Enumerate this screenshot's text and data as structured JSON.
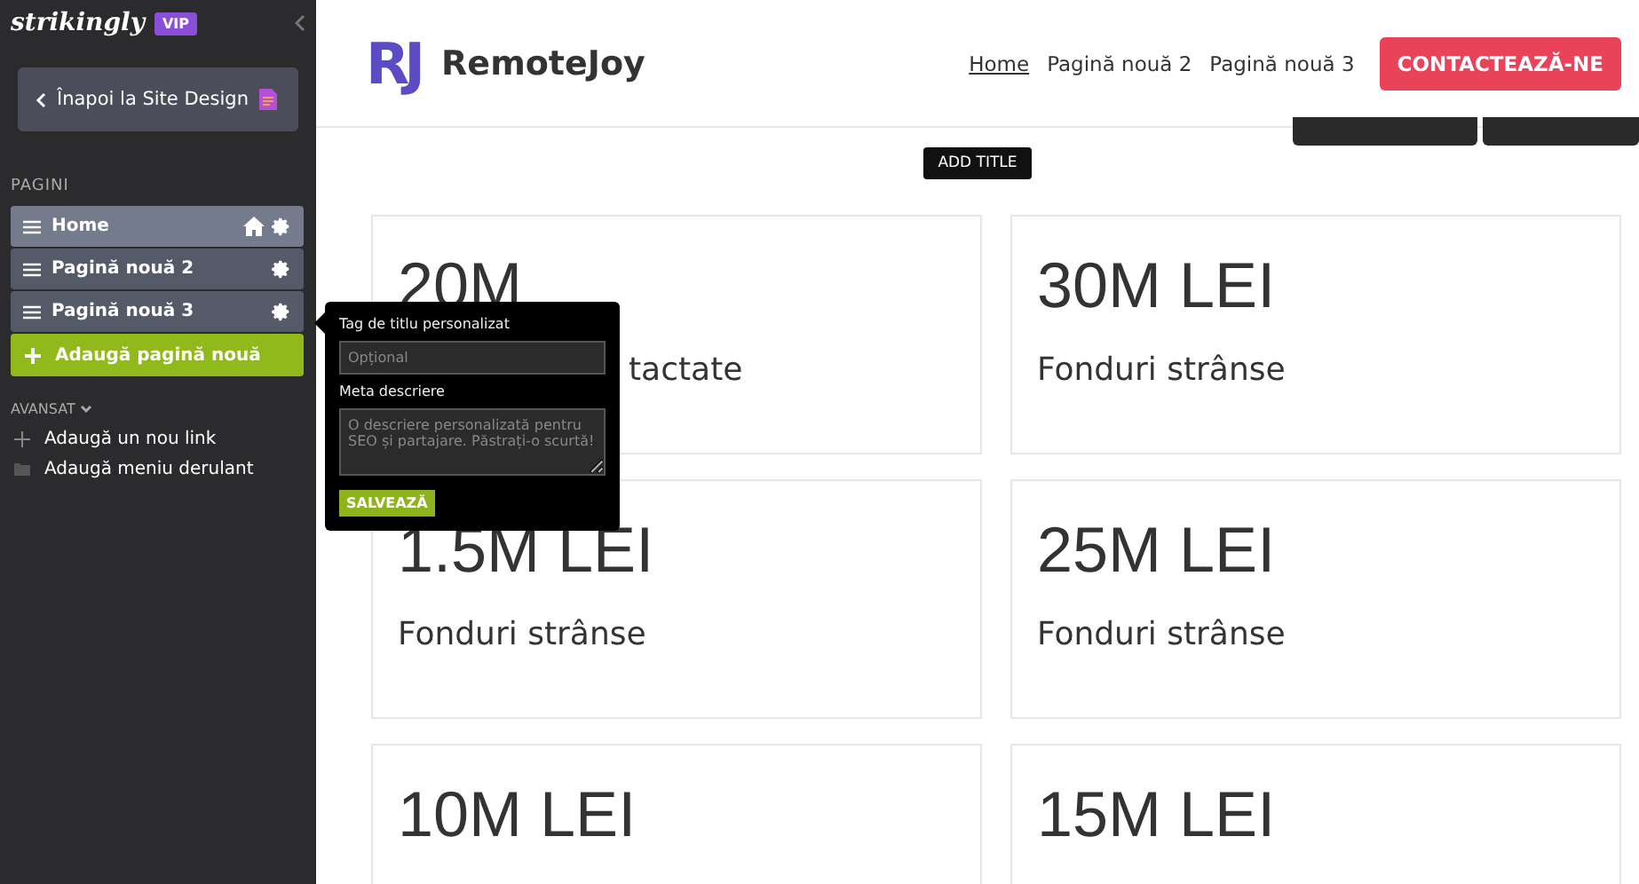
{
  "sidebar": {
    "brand": "strikingly",
    "badge": "VIP",
    "back_button": "Înapoi la Site Design",
    "section_title": "PAGINI",
    "pages": [
      {
        "label": "Home",
        "selected": true,
        "home": true
      },
      {
        "label": "Pagină nouă 2",
        "selected": false,
        "home": false
      },
      {
        "label": "Pagină nouă 3",
        "selected": false,
        "home": false
      }
    ],
    "add_page": "Adaugă pagină nouă",
    "advanced_title": "AVANSAT",
    "advanced_items": [
      {
        "kind": "link",
        "label": "Adaugă un nou link"
      },
      {
        "kind": "folder",
        "label": "Adaugă meniu derulant"
      }
    ]
  },
  "popover": {
    "title_label": "Tag de titlu personalizat",
    "title_placeholder": "Opțional",
    "meta_label": "Meta descriere",
    "meta_placeholder": "O descriere personalizată pentru SEO și partajare. Păstrați-o scurtă!",
    "save": "SALVEAZĂ"
  },
  "header": {
    "logo_mark": "RJ",
    "site_name": "RemoteJoy",
    "nav": [
      {
        "label": "Home",
        "selected": true
      },
      {
        "label": "Pagină nouă 2",
        "selected": false
      },
      {
        "label": "Pagină nouă 3",
        "selected": false
      }
    ],
    "cta": "CONTACTEAZĂ-NE"
  },
  "add_title": "ADD TITLE",
  "cards": [
    {
      "kind": "covered",
      "value": "20M",
      "label": "tactate"
    },
    {
      "kind": "full",
      "value": "30M LEI",
      "label": "Fonduri strânse"
    },
    {
      "kind": "full",
      "value": "1.5M LEI",
      "label": "Fonduri strânse"
    },
    {
      "kind": "full",
      "value": "25M LEI",
      "label": "Fonduri strânse"
    },
    {
      "kind": "full",
      "value": "10M LEI"
    },
    {
      "kind": "full",
      "value": "15M LEI"
    }
  ]
}
